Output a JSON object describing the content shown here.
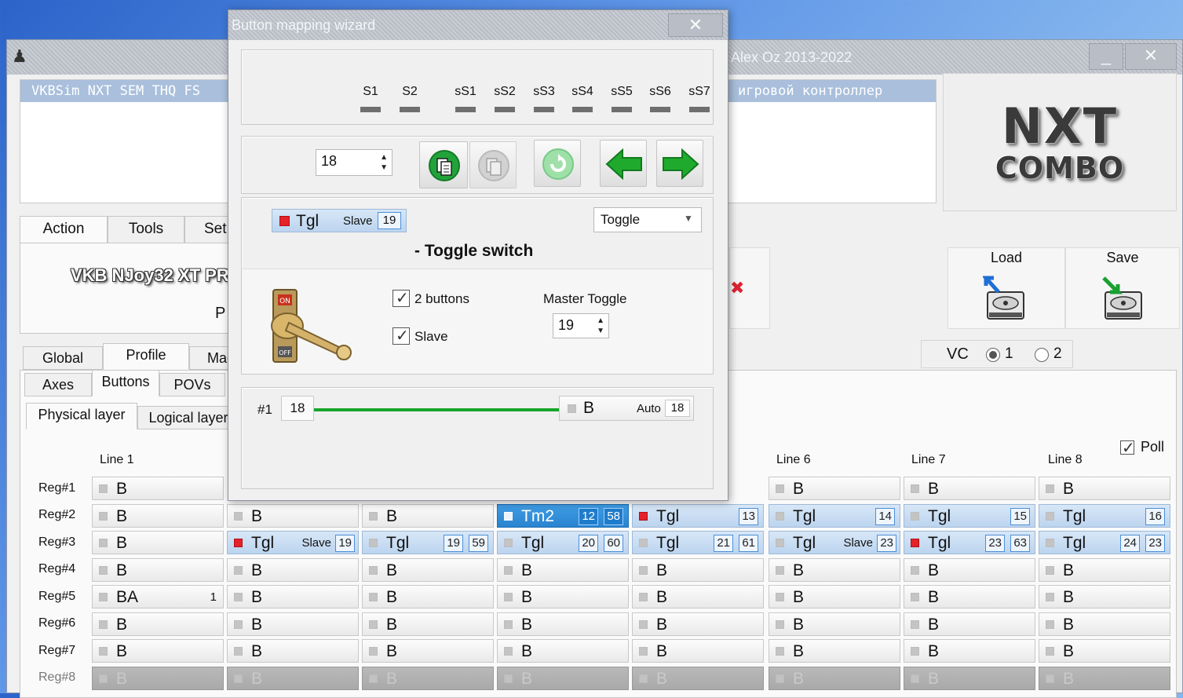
{
  "main_window": {
    "title": "Alex Oz 2013-2022",
    "minimize": "_",
    "close": "✕"
  },
  "device_list": {
    "name": "VKBSim NXT SEM THQ FS",
    "type": "игровой контроллер"
  },
  "logo": {
    "line1": "NXT",
    "line2": "COMBO"
  },
  "top_tabs": [
    "Action",
    "Tools",
    "Set"
  ],
  "device_panel": {
    "name": "VKB NJoy32 XT PR",
    "sub": "P"
  },
  "actions": {
    "load": "Load",
    "save": "Save"
  },
  "vc": {
    "label": "VC",
    "option1": "1",
    "option2": "2",
    "selected": "1"
  },
  "profile_tabs": [
    "Global",
    "Profile",
    "Mac"
  ],
  "control_tabs": [
    "Axes",
    "Buttons",
    "POVs"
  ],
  "layer_tabs": [
    "Physical layer",
    "Logical layer"
  ],
  "poll": {
    "label": "Poll",
    "checked": true
  },
  "grid": {
    "line_labels": [
      "Line 1",
      "Line 6",
      "Line 7",
      "Line 8"
    ],
    "reg_labels": [
      "Reg#1",
      "Reg#2",
      "Reg#3",
      "Reg#4",
      "Reg#5",
      "Reg#6",
      "Reg#7",
      "Reg#8"
    ],
    "cells": {
      "r1": [
        {
          "n": "B"
        },
        {
          "n": "B"
        },
        {
          "n": "B"
        },
        {
          "n": "B"
        }
      ],
      "r2": [
        {
          "n": "B"
        },
        {
          "n": "B"
        },
        {
          "n": "B"
        },
        {
          "n": "Tm2",
          "a": "12",
          "b": "58"
        },
        {
          "n": "Tgl",
          "a": "13"
        },
        {
          "n": "Tgl",
          "a": "14"
        },
        {
          "n": "Tgl",
          "a": "15"
        },
        {
          "n": "Tgl",
          "a": "16"
        }
      ],
      "r3": [
        {
          "n": "B"
        },
        {
          "n": "Tgl",
          "s": "Slave",
          "a": "19"
        },
        {
          "n": "Tgl",
          "a": "19",
          "b": "59"
        },
        {
          "n": "Tgl",
          "a": "20",
          "b": "60"
        },
        {
          "n": "Tgl",
          "a": "21",
          "b": "61"
        },
        {
          "n": "Tgl",
          "s": "Slave",
          "a": "23"
        },
        {
          "n": "Tgl",
          "a": "23",
          "b": "63"
        },
        {
          "n": "Tgl",
          "a": "24",
          "b": "23"
        }
      ],
      "r5_first": {
        "n": "BA",
        "x": "1"
      },
      "plain": "B"
    }
  },
  "wizard": {
    "title": "Button mapping wizard",
    "close": "✕",
    "shifts": [
      "S1",
      "S2",
      "sS1",
      "sS2",
      "sS3",
      "sS4",
      "sS5",
      "sS6",
      "sS7"
    ],
    "button_number": "18",
    "preview": {
      "name": "Tgl",
      "slave": "Slave",
      "num": "19"
    },
    "mode": "Toggle",
    "mode_desc": "- Toggle switch",
    "two_buttons": "2 buttons",
    "slave": "Slave",
    "master_toggle_label": "Master Toggle",
    "master_toggle_value": "19",
    "toggle_image_on": "ON",
    "toggle_image_off": "OFF",
    "mapping": {
      "index": "#1",
      "physical": "18",
      "target_name": "B",
      "target_mode": "Auto",
      "target_num": "18"
    }
  },
  "colors": {
    "selected_cell": "#2a84d0",
    "highlight_cell": "#c7dcf2",
    "led_red": "#e52129",
    "arrow_green": "#1faa2e",
    "map_line": "#16a52a"
  }
}
